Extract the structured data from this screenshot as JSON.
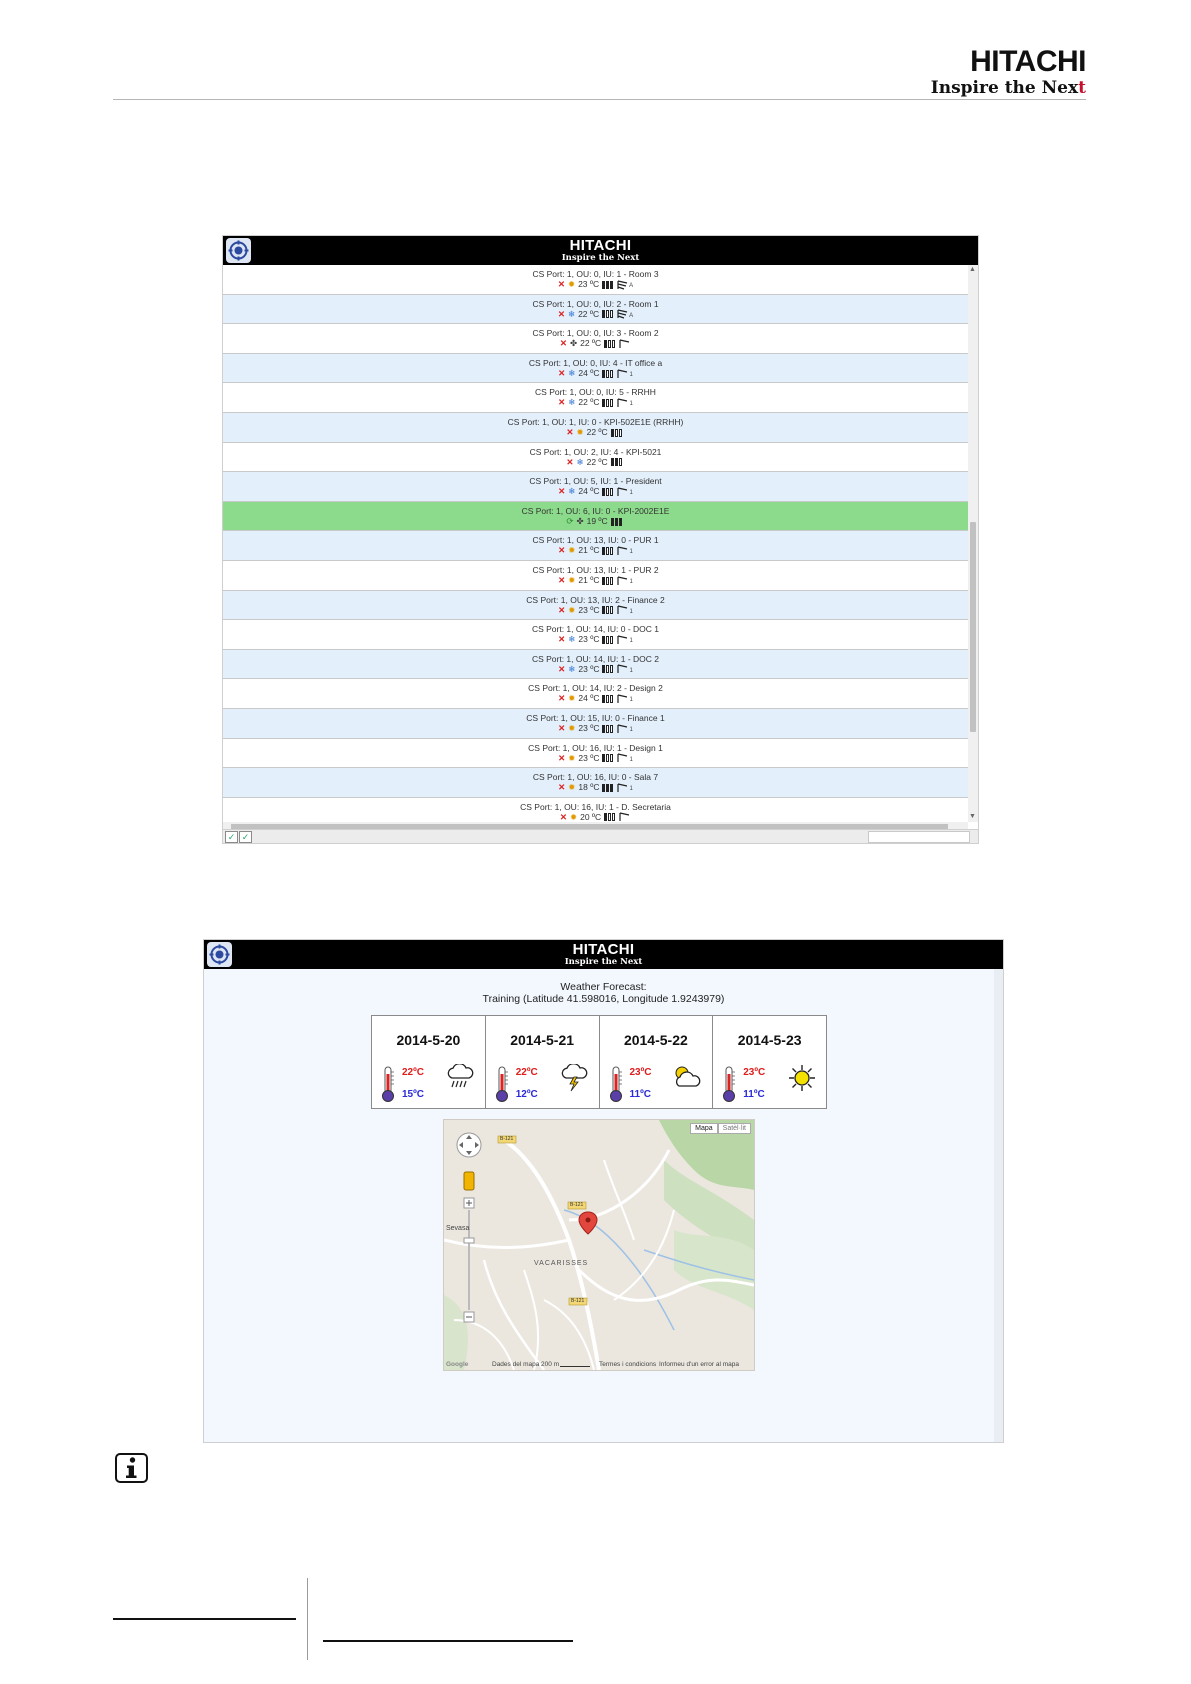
{
  "header": {
    "brand": "HITACHI",
    "tagline_main": "Inspire the Nex",
    "tagline_accent": "t"
  },
  "app": {
    "brand": "HITACHI",
    "tagline": "Inspire the Next"
  },
  "units": [
    {
      "name": "CS Port: 1, OU: 0, IU: 1 - Room 3",
      "mode": "heat",
      "temp": "23 ºC",
      "fan_level": 3,
      "louver": "auto",
      "louver_label": "A",
      "running": false,
      "selected": false
    },
    {
      "name": "CS Port: 1, OU: 0, IU: 2 - Room 1",
      "mode": "cool",
      "temp": "22 ºC",
      "fan_level": 1,
      "louver": "auto",
      "louver_label": "A",
      "running": false,
      "selected": false
    },
    {
      "name": "CS Port: 1, OU: 0, IU: 3 - Room 2",
      "mode": "fan",
      "temp": "22 ºC",
      "fan_level": 1,
      "louver": "fixed",
      "louver_label": "",
      "running": false,
      "selected": false
    },
    {
      "name": "CS Port: 1, OU: 0, IU: 4 - IT office a",
      "mode": "cool",
      "temp": "24 ºC",
      "fan_level": 1,
      "louver": "fixed",
      "louver_label": "1",
      "running": false,
      "selected": false
    },
    {
      "name": "CS Port: 1, OU: 0, IU: 5 - RRHH",
      "mode": "cool",
      "temp": "22 ºC",
      "fan_level": 1,
      "louver": "fixed",
      "louver_label": "1",
      "running": false,
      "selected": false
    },
    {
      "name": "CS Port: 1, OU: 1, IU: 0 - KPI-502E1E (RRHH)",
      "mode": "heat",
      "temp": "22 ºC",
      "fan_level": 1,
      "louver": "none",
      "louver_label": "",
      "running": false,
      "selected": false
    },
    {
      "name": "CS Port: 1, OU: 2, IU: 4 - KPI-5021",
      "mode": "cool",
      "temp": "22 ºC",
      "fan_level": 2,
      "louver": "none",
      "louver_label": "",
      "running": false,
      "selected": false
    },
    {
      "name": "CS Port: 1, OU: 5, IU: 1 - President",
      "mode": "cool",
      "temp": "24 ºC",
      "fan_level": 1,
      "louver": "fixed",
      "louver_label": "1",
      "running": false,
      "selected": false
    },
    {
      "name": "CS Port: 1, OU: 6, IU: 0 - KPI-2002E1E",
      "mode": "fan",
      "temp": "19 ºC",
      "fan_level": 3,
      "louver": "none",
      "louver_label": "",
      "running": true,
      "selected": true
    },
    {
      "name": "CS Port: 1, OU: 13, IU: 0 - PUR 1",
      "mode": "heat",
      "temp": "21 ºC",
      "fan_level": 1,
      "louver": "fixed",
      "louver_label": "1",
      "running": false,
      "selected": false
    },
    {
      "name": "CS Port: 1, OU: 13, IU: 1 - PUR 2",
      "mode": "heat",
      "temp": "21 ºC",
      "fan_level": 1,
      "louver": "fixed",
      "louver_label": "1",
      "running": false,
      "selected": false
    },
    {
      "name": "CS Port: 1, OU: 13, IU: 2 - Finance 2",
      "mode": "heat",
      "temp": "23 ºC",
      "fan_level": 1,
      "louver": "fixed",
      "louver_label": "1",
      "running": false,
      "selected": false
    },
    {
      "name": "CS Port: 1, OU: 14, IU: 0 - DOC 1",
      "mode": "cool",
      "temp": "23 ºC",
      "fan_level": 1,
      "louver": "fixed",
      "louver_label": "1",
      "running": false,
      "selected": false
    },
    {
      "name": "CS Port: 1, OU: 14, IU: 1 - DOC 2",
      "mode": "cool",
      "temp": "23 ºC",
      "fan_level": 1,
      "louver": "fixed",
      "louver_label": "1",
      "running": false,
      "selected": false
    },
    {
      "name": "CS Port: 1, OU: 14, IU: 2 - Design 2",
      "mode": "heat",
      "temp": "24 ºC",
      "fan_level": 1,
      "louver": "fixed",
      "louver_label": "1",
      "running": false,
      "selected": false
    },
    {
      "name": "CS Port: 1, OU: 15, IU: 0 - Finance 1",
      "mode": "heat",
      "temp": "23 ºC",
      "fan_level": 1,
      "louver": "fixed",
      "louver_label": "1",
      "running": false,
      "selected": false
    },
    {
      "name": "CS Port: 1, OU: 16, IU: 1 - Design 1",
      "mode": "heat",
      "temp": "23 ºC",
      "fan_level": 1,
      "louver": "fixed",
      "louver_label": "1",
      "running": false,
      "selected": false
    },
    {
      "name": "CS Port: 1, OU: 16, IU: 0 - Sala 7",
      "mode": "heat",
      "temp": "18 ºC",
      "fan_level": 3,
      "louver": "fixed",
      "louver_label": "1",
      "running": false,
      "selected": false
    },
    {
      "name": "CS Port: 1, OU: 16, IU: 1 - D. Secretaria",
      "mode": "heat",
      "temp": "20 ºC",
      "fan_level": 1,
      "louver": "fixed",
      "louver_label": "",
      "running": false,
      "selected": false
    }
  ],
  "weather": {
    "title": "Weather Forecast:",
    "location": "Training (Latitude 41.598016, Longitude 1.9243979)",
    "days": [
      {
        "date": "2014-5-20",
        "max": "22ºC",
        "min": "15ºC",
        "icon": "rain-cloud-icon"
      },
      {
        "date": "2014-5-21",
        "max": "22ºC",
        "min": "12ºC",
        "icon": "storm-cloud-icon"
      },
      {
        "date": "2014-5-22",
        "max": "23ºC",
        "min": "11ºC",
        "icon": "partly-cloudy-icon"
      },
      {
        "date": "2014-5-23",
        "max": "23ºC",
        "min": "11ºC",
        "icon": "sun-icon"
      }
    ],
    "map": {
      "type_map": "Mapa",
      "type_satellite": "Satèl·lit",
      "town": "VACARISSES",
      "place_west": "Sevasa",
      "road_1": "B-121",
      "road_2": "B-121",
      "road_3": "B-121",
      "footer_data": "Dades del mapa",
      "footer_scale": "200 m",
      "footer_terms": "Termes i condicions",
      "footer_report": "Informeu d'un error al mapa",
      "google": "Google"
    }
  }
}
